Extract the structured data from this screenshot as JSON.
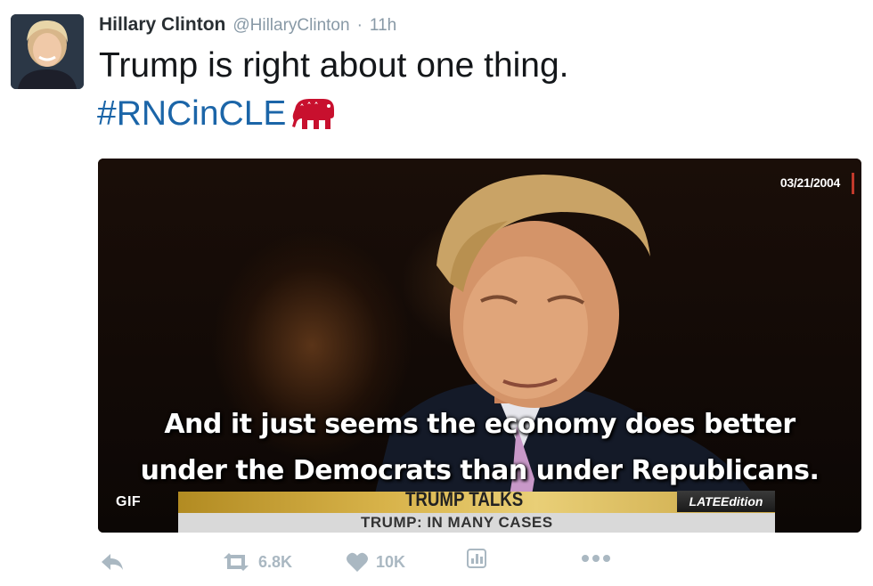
{
  "tweet": {
    "author_name": "Hillary Clinton",
    "handle": "@HillaryClinton",
    "separator": "·",
    "time": "11h",
    "text": "Trump is right about one thing.",
    "hashtag": "#RNCinCLE"
  },
  "media": {
    "date_stamp": "03/21/2004",
    "subtitle_line1": "And it just seems the economy does better",
    "subtitle_line2": "under the Democrats than under Republicans.",
    "ticker_title": "TRUMP TALKS",
    "ticker_brand": "LATEEdition",
    "ticker_subtitle": "TRUMP: IN MANY CASES",
    "badge": "GIF"
  },
  "actions": {
    "retweet_count": "6.8K",
    "like_count": "10K"
  },
  "colors": {
    "hashtag": "#1b65a8",
    "elephant": "#c8102e",
    "action_gray": "#aab8c2",
    "name": "#292f33",
    "meta_gray": "#8899a6"
  },
  "icons": [
    "reply-icon",
    "retweet-icon",
    "heart-icon",
    "analytics-icon",
    "more-icon",
    "elephant-emoji-icon"
  ]
}
